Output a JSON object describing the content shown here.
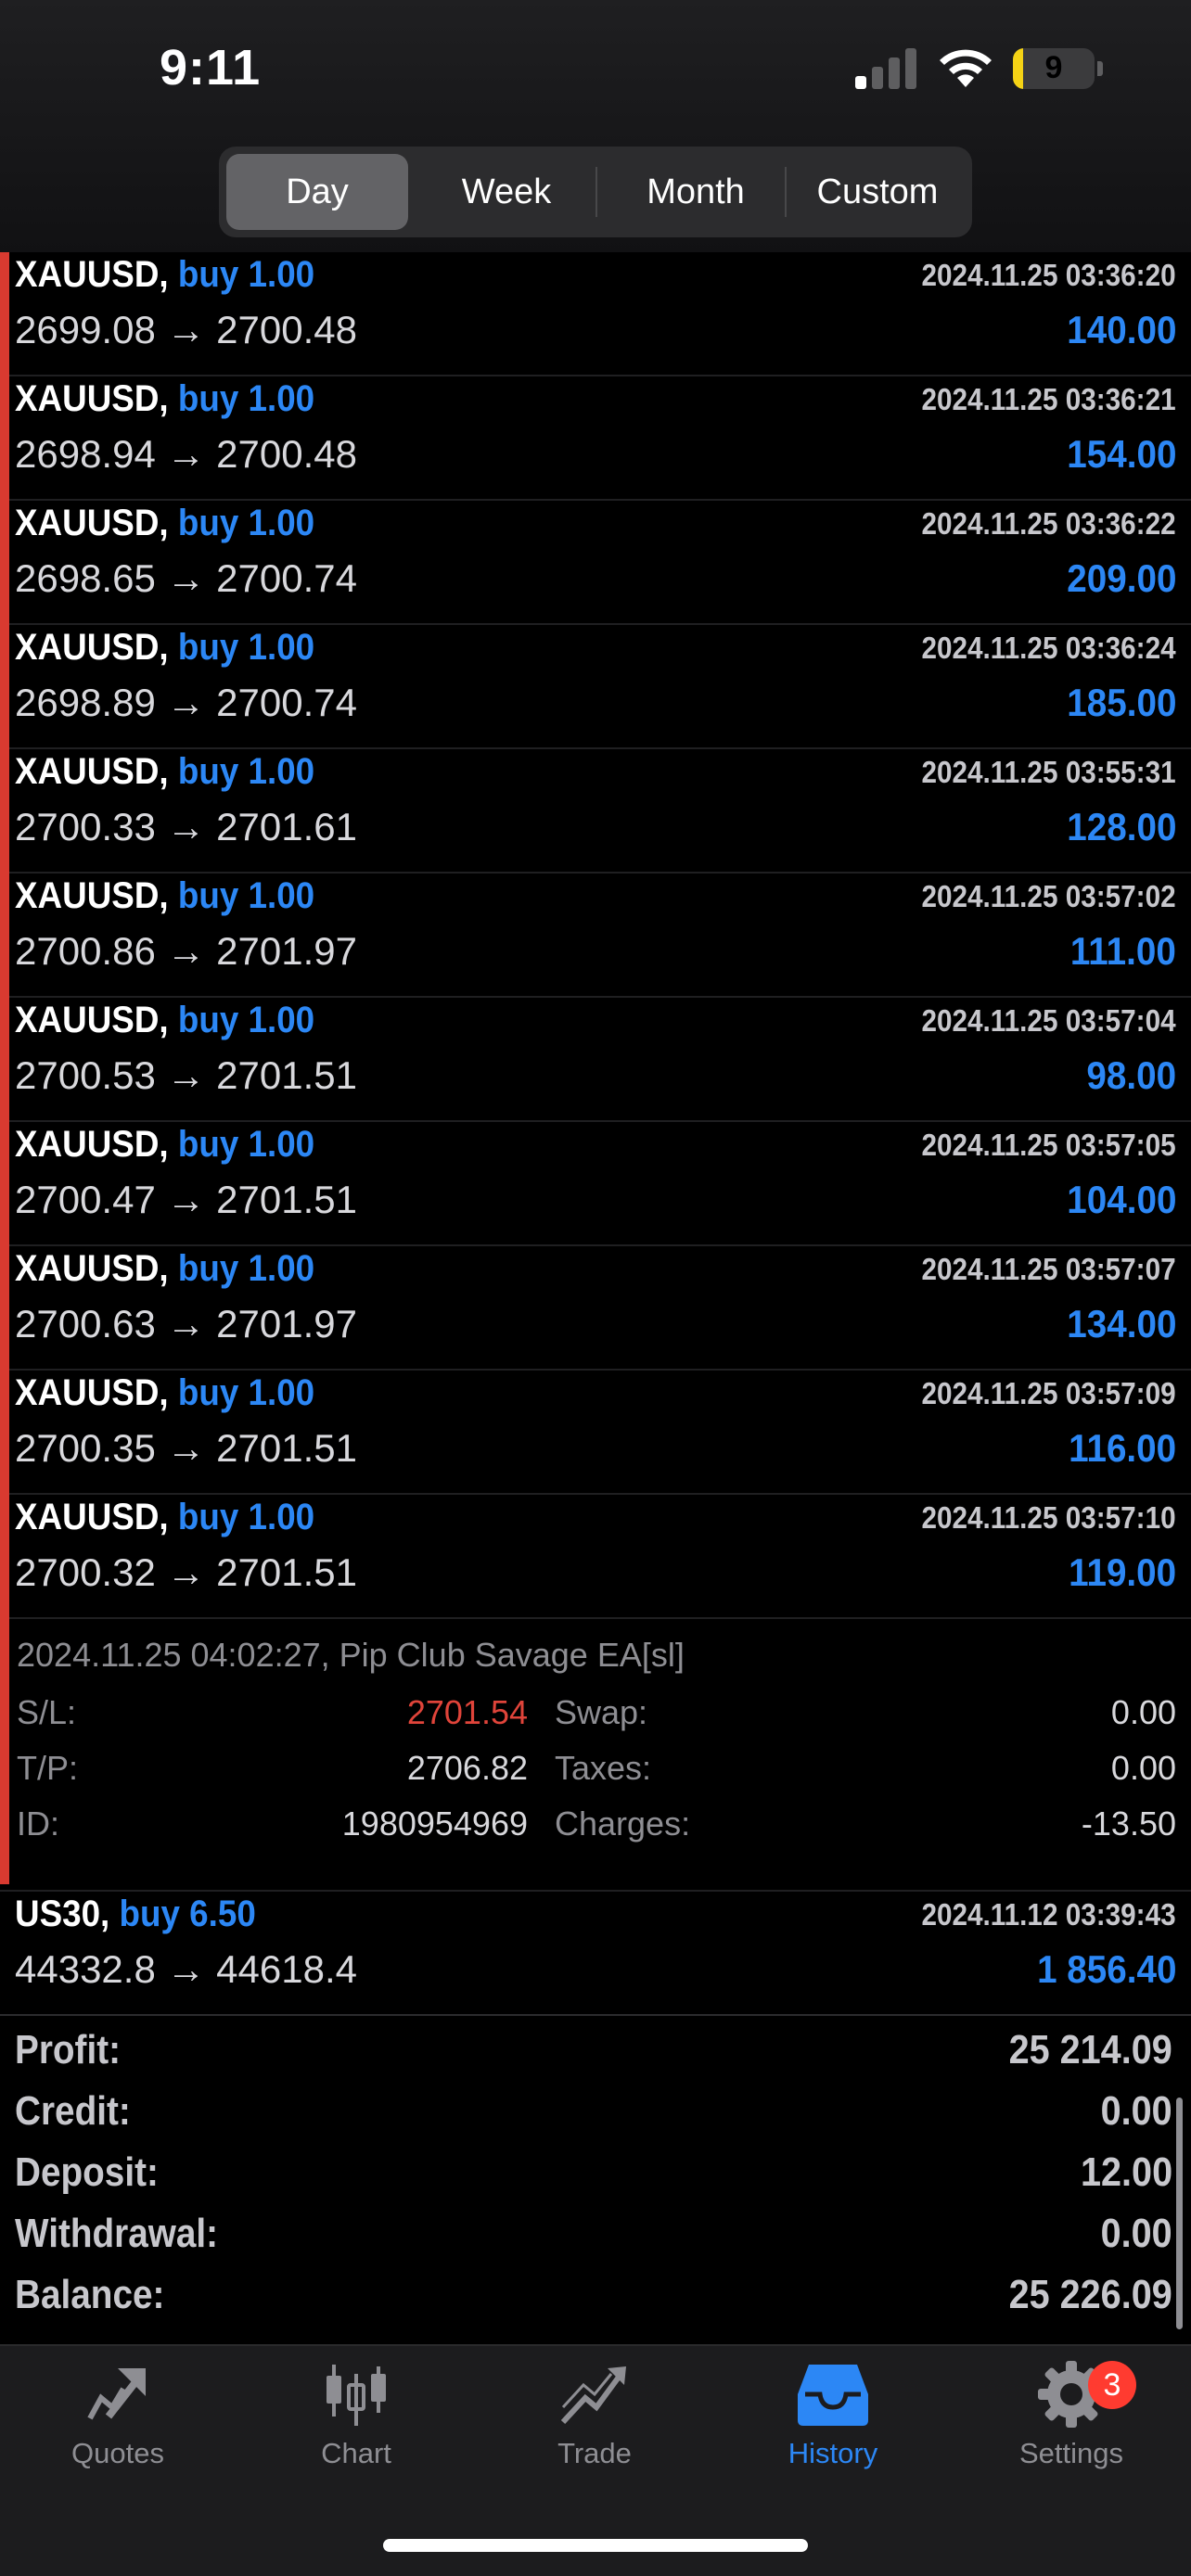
{
  "status_bar": {
    "time": "9:11",
    "battery": "9",
    "battery_fraction": 0.12
  },
  "period_tabs": [
    {
      "label": "Day",
      "active": true
    },
    {
      "label": "Week",
      "active": false
    },
    {
      "label": "Month",
      "active": false
    },
    {
      "label": "Custom",
      "active": false
    }
  ],
  "deals": [
    {
      "symbol": "XAUUSD,",
      "side": "buy 1.00",
      "time": "2024.11.25 03:36:20",
      "open": "2699.08",
      "close": "2700.48",
      "profit": "140.00"
    },
    {
      "symbol": "XAUUSD,",
      "side": "buy 1.00",
      "time": "2024.11.25 03:36:21",
      "open": "2698.94",
      "close": "2700.48",
      "profit": "154.00"
    },
    {
      "symbol": "XAUUSD,",
      "side": "buy 1.00",
      "time": "2024.11.25 03:36:22",
      "open": "2698.65",
      "close": "2700.74",
      "profit": "209.00"
    },
    {
      "symbol": "XAUUSD,",
      "side": "buy 1.00",
      "time": "2024.11.25 03:36:24",
      "open": "2698.89",
      "close": "2700.74",
      "profit": "185.00"
    },
    {
      "symbol": "XAUUSD,",
      "side": "buy 1.00",
      "time": "2024.11.25 03:55:31",
      "open": "2700.33",
      "close": "2701.61",
      "profit": "128.00"
    },
    {
      "symbol": "XAUUSD,",
      "side": "buy 1.00",
      "time": "2024.11.25 03:57:02",
      "open": "2700.86",
      "close": "2701.97",
      "profit": "111.00"
    },
    {
      "symbol": "XAUUSD,",
      "side": "buy 1.00",
      "time": "2024.11.25 03:57:04",
      "open": "2700.53",
      "close": "2701.51",
      "profit": "98.00"
    },
    {
      "symbol": "XAUUSD,",
      "side": "buy 1.00",
      "time": "2024.11.25 03:57:05",
      "open": "2700.47",
      "close": "2701.51",
      "profit": "104.00"
    },
    {
      "symbol": "XAUUSD,",
      "side": "buy 1.00",
      "time": "2024.11.25 03:57:07",
      "open": "2700.63",
      "close": "2701.97",
      "profit": "134.00"
    },
    {
      "symbol": "XAUUSD,",
      "side": "buy 1.00",
      "time": "2024.11.25 03:57:09",
      "open": "2700.35",
      "close": "2701.51",
      "profit": "116.00"
    },
    {
      "symbol": "XAUUSD,",
      "side": "buy 1.00",
      "time": "2024.11.25 03:57:10",
      "open": "2700.32",
      "close": "2701.51",
      "profit": "119.00"
    }
  ],
  "arrow": "→",
  "expanded_detail": {
    "comment": "2024.11.25 04:02:27, Pip Club Savage EA[sl]",
    "sl_label": "S/L:",
    "sl_value": "2701.54",
    "tp_label": "T/P:",
    "tp_value": "2706.82",
    "id_label": "ID:",
    "id_value": "1980954969",
    "swap_label": "Swap:",
    "swap_value": "0.00",
    "taxes_label": "Taxes:",
    "taxes_value": "0.00",
    "charges_label": "Charges:",
    "charges_value": "-13.50"
  },
  "last_deal": {
    "symbol": "US30,",
    "side": "buy 6.50",
    "time": "2024.11.12 03:39:43",
    "open": "44332.8",
    "close": "44618.4",
    "profit": "1 856.40"
  },
  "summary": [
    {
      "label": "Profit:",
      "value": "25 214.09"
    },
    {
      "label": "Credit:",
      "value": "0.00"
    },
    {
      "label": "Deposit:",
      "value": "12.00"
    },
    {
      "label": "Withdrawal:",
      "value": "0.00"
    },
    {
      "label": "Balance:",
      "value": "25 226.09"
    }
  ],
  "tabbar": [
    {
      "label": "Quotes",
      "icon": "quotes-icon"
    },
    {
      "label": "Chart",
      "icon": "chart-icon"
    },
    {
      "label": "Trade",
      "icon": "trade-icon"
    },
    {
      "label": "History",
      "icon": "history-icon",
      "active": true
    },
    {
      "label": "Settings",
      "icon": "gear-icon",
      "badge": "3"
    }
  ],
  "colors": {
    "accent": "#2c87f5",
    "loss_marker": "#d93a30",
    "sl_value": "#e0443a"
  }
}
